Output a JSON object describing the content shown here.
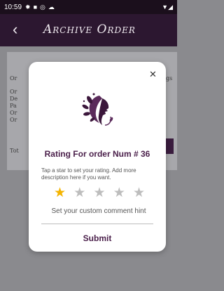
{
  "status_bar": {
    "time": "10:59"
  },
  "header": {
    "title": "Archive Order"
  },
  "background": {
    "line1": "Or",
    "line1_right": "gs",
    "lines": [
      "Or",
      "De",
      "Pa",
      "Or",
      "Or"
    ],
    "total_prefix": "Tot"
  },
  "dialog": {
    "title": "Rating For order Num # 36",
    "description": "Tap a star to set your rating. Add more description here if you want.",
    "rating": 1,
    "max_rating": 5,
    "comment_hint": "Set your custom comment hint",
    "submit_label": "Submit"
  },
  "colors": {
    "primary": "#4a1f4a",
    "star_active": "#f4b400",
    "star_inactive": "#bdbdbd",
    "appbar": "#2c1730"
  }
}
